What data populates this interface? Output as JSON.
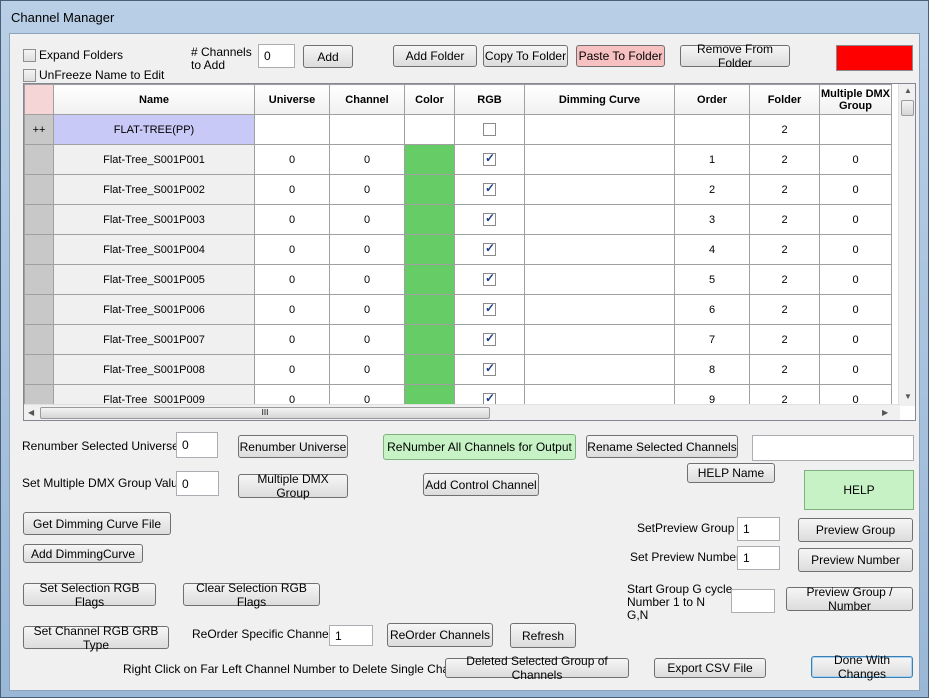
{
  "window": {
    "title": "Channel Manager"
  },
  "top": {
    "expand_folders": "Expand Folders",
    "unfreeze_name": "UnFreeze Name to Edit",
    "channels_to_add_label_1": "# Channels",
    "channels_to_add_label_2": "to Add",
    "channels_to_add_value": "0",
    "add_button": "Add",
    "add_folder_button": "Add Folder",
    "copy_to_folder_button": "Copy To Folder",
    "paste_to_folder_button": "Paste To Folder",
    "remove_from_folder_button": "Remove From Folder",
    "color_swatch": "#ff0000"
  },
  "grid": {
    "columns": [
      "Name",
      "Universe",
      "Channel",
      "Color",
      "RGB",
      "Dimming Curve",
      "Order",
      "Folder",
      "Multiple DMX Group"
    ],
    "folder_row": {
      "marker": "++",
      "name": "FLAT-TREE(PP)",
      "folder": "2",
      "rgb_checked": false
    },
    "rows": [
      {
        "name": "Flat-Tree_S001P001",
        "universe": "0",
        "channel": "0",
        "order": "1",
        "folder": "2",
        "dmx": "0"
      },
      {
        "name": "Flat-Tree_S001P002",
        "universe": "0",
        "channel": "0",
        "order": "2",
        "folder": "2",
        "dmx": "0"
      },
      {
        "name": "Flat-Tree_S001P003",
        "universe": "0",
        "channel": "0",
        "order": "3",
        "folder": "2",
        "dmx": "0"
      },
      {
        "name": "Flat-Tree_S001P004",
        "universe": "0",
        "channel": "0",
        "order": "4",
        "folder": "2",
        "dmx": "0"
      },
      {
        "name": "Flat-Tree_S001P005",
        "universe": "0",
        "channel": "0",
        "order": "5",
        "folder": "2",
        "dmx": "0"
      },
      {
        "name": "Flat-Tree_S001P006",
        "universe": "0",
        "channel": "0",
        "order": "6",
        "folder": "2",
        "dmx": "0"
      },
      {
        "name": "Flat-Tree_S001P007",
        "universe": "0",
        "channel": "0",
        "order": "7",
        "folder": "2",
        "dmx": "0"
      },
      {
        "name": "Flat-Tree_S001P008",
        "universe": "0",
        "channel": "0",
        "order": "8",
        "folder": "2",
        "dmx": "0"
      },
      {
        "name": "Flat-Tree_S001P009",
        "universe": "0",
        "channel": "0",
        "order": "9",
        "folder": "2",
        "dmx": "0"
      }
    ],
    "row_color": "#66cc66",
    "scroll_grip": "III"
  },
  "bottom": {
    "renumber_universe_label": "Renumber Selected Universe",
    "renumber_universe_value": "0",
    "renumber_universe_button": "Renumber Universe",
    "renumber_all_button": "ReNumber All Channels for Output",
    "rename_selected_button": "Rename Selected Channels",
    "rename_value": "",
    "help_name_button": "HELP Name",
    "help_button": "HELP",
    "dmx_group_label": "Set Multiple DMX Group Value",
    "dmx_group_value": "0",
    "dmx_group_button": "Multiple DMX Group",
    "add_control_channel_button": "Add Control Channel",
    "get_dimming_button": "Get Dimming Curve File",
    "add_dimming_button": "Add DimmingCurve",
    "set_preview_group_label": "SetPreview Group",
    "set_preview_group_value": "1",
    "preview_group_button": "Preview Group",
    "set_preview_number_label": "Set Preview Number",
    "set_preview_number_value": "1",
    "preview_number_button": "Preview Number",
    "start_group_label_1": "Start Group G cycle",
    "start_group_label_2": "Number 1 to N",
    "start_group_label_3": "G,N",
    "start_group_value": "",
    "preview_group_number_button": "Preview Group / Number",
    "set_selection_rgb_button": "Set Selection RGB Flags",
    "clear_selection_rgb_button": "Clear Selection RGB Flags",
    "set_channel_rgb_grb_button": "Set Channel RGB GRB Type",
    "reorder_label": "ReOrder Specific Channels",
    "reorder_value": "1",
    "reorder_button": "ReOrder Channels",
    "refresh_button": "Refresh",
    "right_click_hint": "Right Click on Far Left Channel Number to Delete Single Channel",
    "deleted_selected_button": "Deleted Selected Group of Channels",
    "export_csv_button": "Export CSV File",
    "done_button": "Done With Changes"
  }
}
